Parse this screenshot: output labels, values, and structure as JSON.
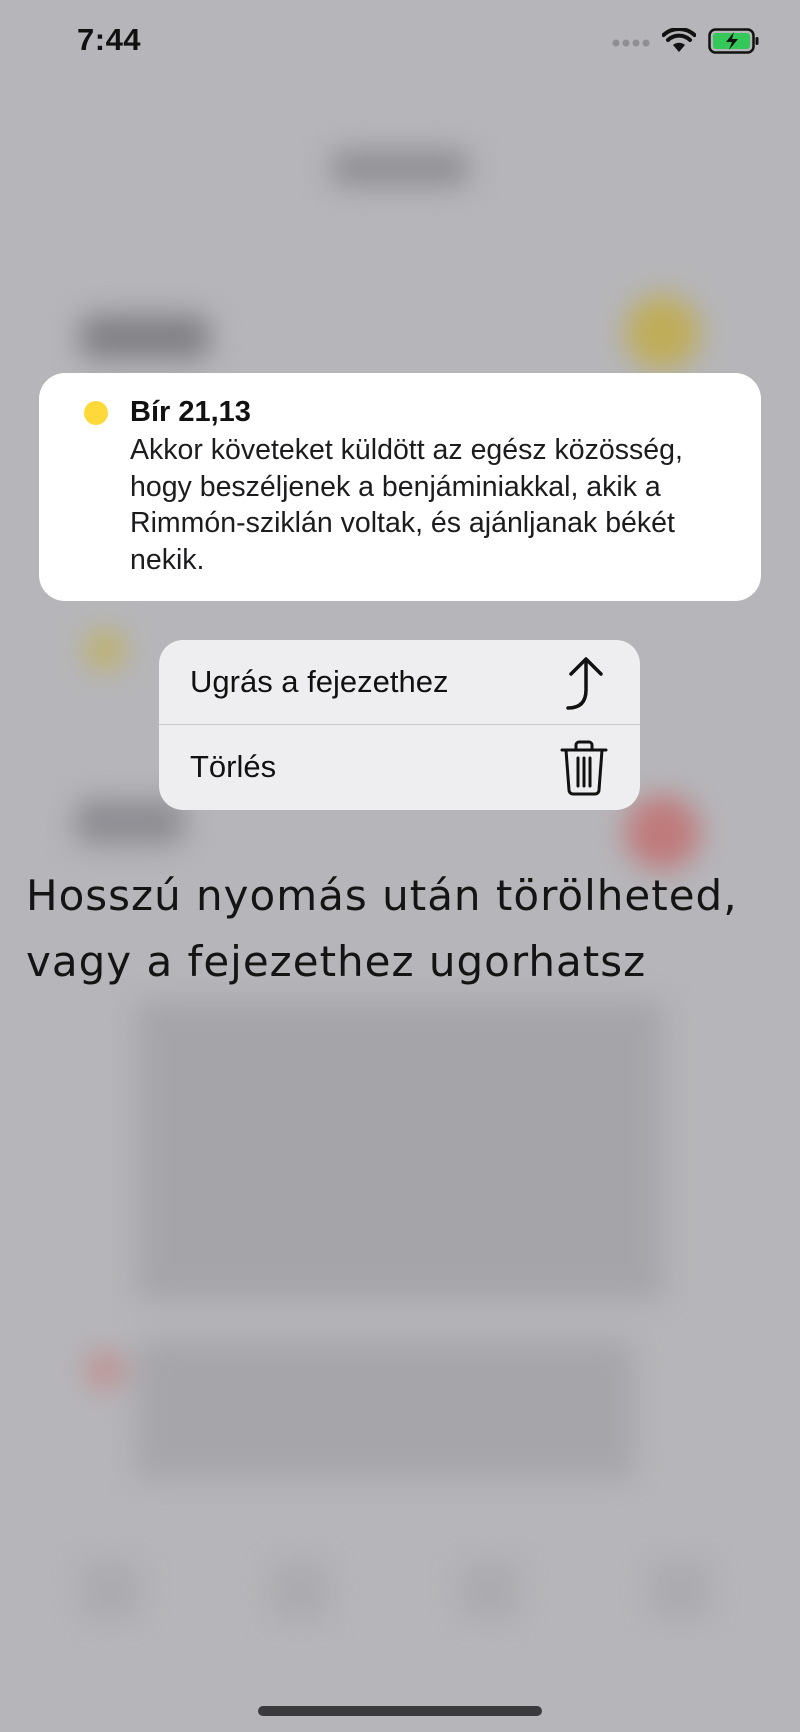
{
  "status_bar": {
    "time": "7:44",
    "signal_icon": "signal-dots-icon",
    "wifi_icon": "wifi-icon",
    "battery_icon": "battery-charging-icon",
    "battery_color": "#34c759"
  },
  "verse": {
    "reference": "Bír 21,13",
    "text": "Akkor követeket küldött az egész közösség, hogy beszéljenek a benjáminiakkal, akik a Rimmón-sziklán voltak, és ajánljanak békét nekik.",
    "highlight_color": "#ffd83a"
  },
  "context_menu": {
    "items": [
      {
        "label": "Ugrás a fejezethez",
        "icon": "jump-arrow-icon"
      },
      {
        "label": "Törlés",
        "icon": "trash-icon"
      }
    ]
  },
  "caption": {
    "line1": "Hosszú nyomás után törölheted,",
    "line2": "vagy a fejezethez ugorhatsz"
  }
}
